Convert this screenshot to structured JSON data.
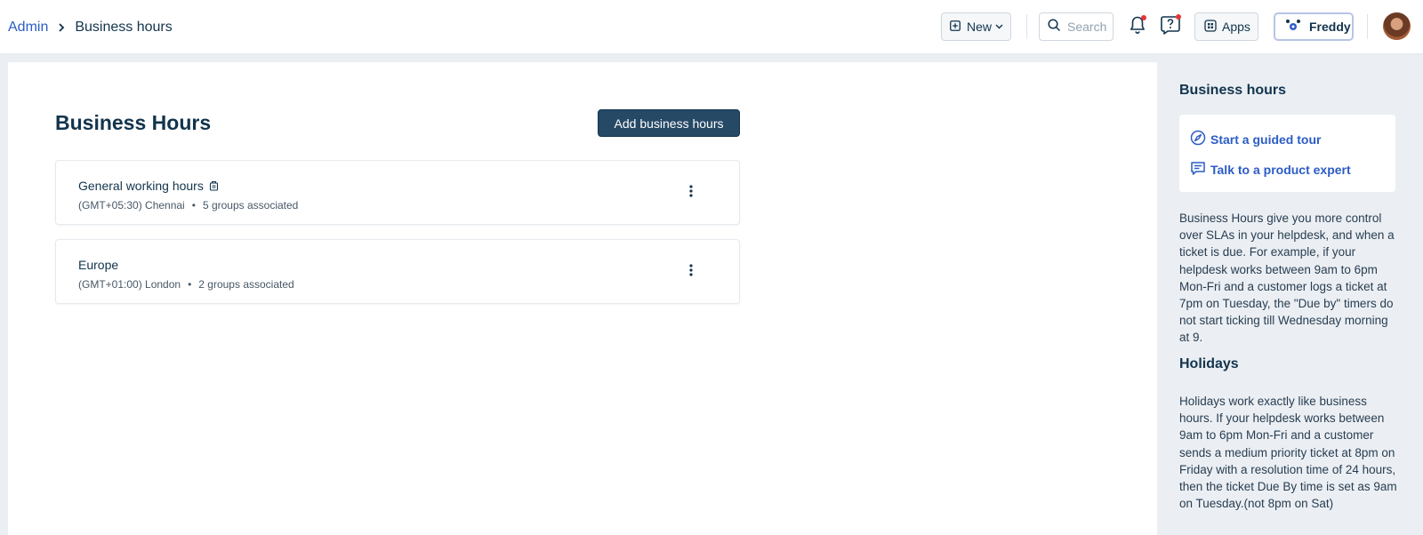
{
  "breadcrumb": {
    "parent": "Admin",
    "current": "Business hours"
  },
  "header": {
    "new_label": "New",
    "search_placeholder": "Search",
    "apps_label": "Apps",
    "freddy_label": "Freddy",
    "icons": [
      "plus-square-icon",
      "chevron-down-icon",
      "search-icon",
      "bell-icon",
      "help-icon",
      "apps-icon",
      "freddy-icon"
    ],
    "accent_color": "#2c5cc5",
    "notification_dot_color": "#e43538"
  },
  "main": {
    "title": "Business Hours",
    "add_button_label": "Add business hours",
    "cards": [
      {
        "name": "General working hours",
        "timezone": "(GMT+05:30) Chennai",
        "groups": "5 groups associated",
        "default": true
      },
      {
        "name": "Europe",
        "timezone": "(GMT+01:00) London",
        "groups": "2 groups associated",
        "default": false
      }
    ]
  },
  "sidebar": {
    "title": "Business hours",
    "links": [
      {
        "label": "Start a guided tour",
        "icon": "compass-icon"
      },
      {
        "label": "Talk to a product expert",
        "icon": "chat-icon"
      }
    ],
    "description": "Business Hours give you more control over SLAs in your helpdesk, and when a ticket is due. For example, if your helpdesk works between 9am to 6pm Mon-Fri and a customer logs a ticket at 7pm on Tuesday, the \"Due by\" timers do not start ticking till Wednesday morning at 9.",
    "holidays_title": "Holidays",
    "holidays_description": "Holidays work exactly like business hours. If your helpdesk works between 9am to 6pm Mon-Fri and a customer sends a medium priority ticket at 8pm on Friday with a resolution time of 24 hours, then the ticket Due By time is set as 9am on Tuesday.(not 8pm on Sat)"
  }
}
